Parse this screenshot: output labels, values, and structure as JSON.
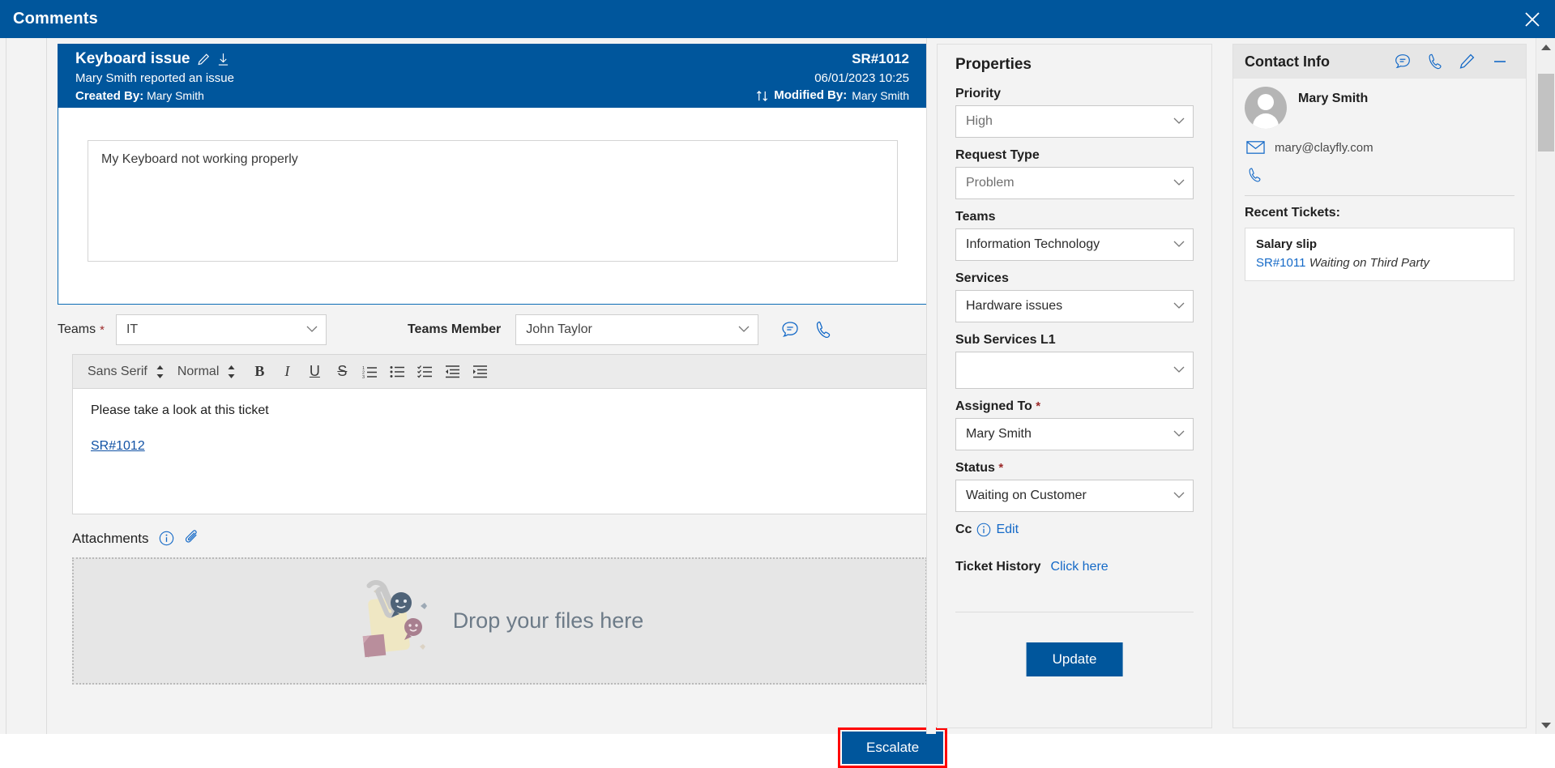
{
  "window": {
    "title": "Comments",
    "close_icon": "close-icon"
  },
  "ticket": {
    "title": "Keyboard issue",
    "edit_icon": "pencil-icon",
    "download_icon": "download-icon",
    "subtitle": "Mary Smith reported an issue",
    "created_by_label": "Created By:",
    "created_by": "Mary Smith",
    "sr_number": "SR#1012",
    "datetime": "06/01/2023 10:25",
    "sort_icon": "sort-updown-icon",
    "modified_by_label": "Modified By:",
    "modified_by": "Mary Smith",
    "description": "My Keyboard not working properly"
  },
  "teams_row": {
    "teams_label": "Teams",
    "teams_required": "*",
    "teams_value": "IT",
    "member_label": "Teams Member",
    "member_value": "John Taylor",
    "chat_icon": "chat-icon",
    "phone_icon": "phone-icon"
  },
  "editor": {
    "font_family": "Sans Serif",
    "font_size": "Normal",
    "buttons": [
      {
        "name": "bold-button",
        "label": "B"
      },
      {
        "name": "italic-button",
        "label": "I"
      },
      {
        "name": "underline-button",
        "label": "U"
      },
      {
        "name": "strikethrough-button",
        "label": "S"
      },
      {
        "name": "ordered-list-button",
        "label": "ordered-list-icon"
      },
      {
        "name": "bullet-list-button",
        "label": "bullet-list-icon"
      },
      {
        "name": "check-list-button",
        "label": "check-list-icon"
      },
      {
        "name": "outdent-button",
        "label": "outdent-icon"
      },
      {
        "name": "indent-button",
        "label": "indent-icon"
      }
    ],
    "body_text": "Please take a look at this ticket",
    "body_link": "SR#1012"
  },
  "attachments": {
    "label": "Attachments",
    "info_icon": "info-icon",
    "clip_icon": "paperclip-icon",
    "dropzone_text": "Drop your files here"
  },
  "actions": {
    "escalate_label": "Escalate",
    "escalate_highlight_color": "#ff0000",
    "update_label": "Update"
  },
  "properties": {
    "heading": "Properties",
    "fields": [
      {
        "label": "Priority",
        "required": "",
        "value": "High",
        "tone": "muted"
      },
      {
        "label": "Request Type",
        "required": "",
        "value": "Problem",
        "tone": "muted"
      },
      {
        "label": "Teams",
        "required": "",
        "value": "Information Technology",
        "tone": "dark"
      },
      {
        "label": "Services",
        "required": "",
        "value": "Hardware issues",
        "tone": "dark"
      },
      {
        "label": "Sub Services L1",
        "required": "",
        "value": "",
        "tone": "dark"
      },
      {
        "label": "Assigned To",
        "required": "*",
        "value": "Mary Smith",
        "tone": "dark"
      },
      {
        "label": "Status",
        "required": "*",
        "value": "Waiting on Customer",
        "tone": "dark"
      }
    ],
    "cc_label": "Cc",
    "cc_info_icon": "info-icon",
    "cc_edit": "Edit",
    "history_label": "Ticket History",
    "history_link": "Click here"
  },
  "contact": {
    "heading": "Contact Info",
    "header_icons": [
      {
        "name": "chat-icon"
      },
      {
        "name": "phone-icon"
      },
      {
        "name": "pencil-icon"
      },
      {
        "name": "minimize-icon"
      }
    ],
    "name": "Mary Smith",
    "email_icon": "mail-icon",
    "email": "mary@clayfly.com",
    "phone_icon": "phone-icon",
    "recent_label": "Recent Tickets:",
    "recent_tickets": [
      {
        "title": "Salary slip",
        "id": "SR#1011",
        "status": "Waiting on Third Party"
      }
    ]
  },
  "scrollbar": {
    "up_icon": "scroll-up-arrow-icon",
    "down_icon": "scroll-down-arrow-icon",
    "thumb": "scrollbar-thumb"
  },
  "theme": {
    "brand_blue": "#00569c",
    "link_blue": "#1469c7",
    "panel_bg": "#f3f3f3",
    "highlight_red": "#ff0000"
  }
}
